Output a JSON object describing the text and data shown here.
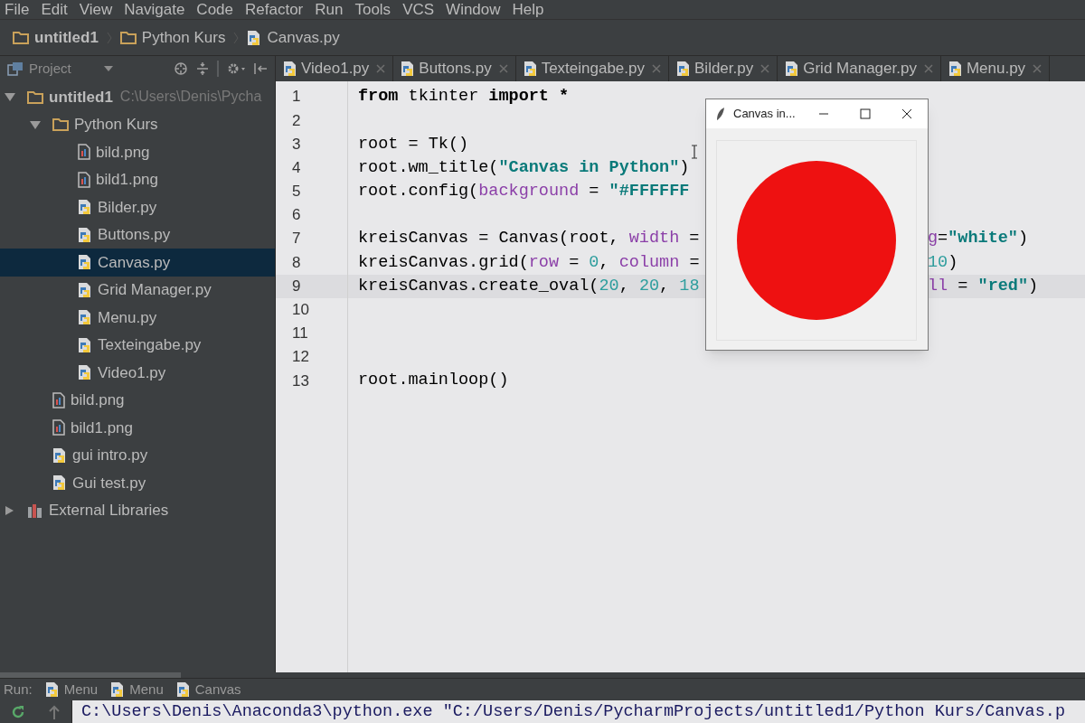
{
  "menu": [
    "File",
    "Edit",
    "View",
    "Navigate",
    "Code",
    "Refactor",
    "Run",
    "Tools",
    "VCS",
    "Window",
    "Help"
  ],
  "breadcrumbs": [
    {
      "label": "untitled1",
      "kind": "project"
    },
    {
      "label": "Python Kurs",
      "kind": "folder"
    },
    {
      "label": "Canvas.py",
      "kind": "python"
    }
  ],
  "project_panel": {
    "title": "Project"
  },
  "tabs": [
    {
      "label": "Video1.py",
      "selected": false
    },
    {
      "label": "Buttons.py",
      "selected": false
    },
    {
      "label": "Texteingabe.py",
      "selected": false
    },
    {
      "label": "Bilder.py",
      "selected": false
    },
    {
      "label": "Grid Manager.py",
      "selected": false
    },
    {
      "label": "Menu.py",
      "selected": false
    }
  ],
  "tree": [
    {
      "label": "untitled1",
      "path": "C:\\Users\\Denis\\Pycha",
      "kind": "project",
      "expanded": true,
      "selected": false,
      "children": [
        {
          "label": "Python Kurs",
          "kind": "folder",
          "expanded": true,
          "selected": false,
          "children": [
            {
              "label": "bild.png",
              "kind": "image",
              "selected": false
            },
            {
              "label": "bild1.png",
              "kind": "image",
              "selected": false
            },
            {
              "label": "Bilder.py",
              "kind": "python",
              "selected": false
            },
            {
              "label": "Buttons.py",
              "kind": "python",
              "selected": false
            },
            {
              "label": "Canvas.py",
              "kind": "python",
              "selected": true
            },
            {
              "label": "Grid Manager.py",
              "kind": "python",
              "selected": false
            },
            {
              "label": "Menu.py",
              "kind": "python",
              "selected": false
            },
            {
              "label": "Texteingabe.py",
              "kind": "python",
              "selected": false
            },
            {
              "label": "Video1.py",
              "kind": "python",
              "selected": false
            }
          ]
        },
        {
          "label": "bild.png",
          "kind": "image",
          "selected": false
        },
        {
          "label": "bild1.png",
          "kind": "image",
          "selected": false
        },
        {
          "label": "gui intro.py",
          "kind": "python",
          "selected": false
        },
        {
          "label": "Gui test.py",
          "kind": "python",
          "selected": false
        }
      ]
    },
    {
      "label": "External Libraries",
      "kind": "library",
      "expanded": false,
      "selected": false
    }
  ],
  "editor": {
    "lines": [
      {
        "number": "1",
        "current": false,
        "left": [
          {
            "text": "from",
            "kind": "keyword"
          },
          {
            "text": " tkinter ",
            "kind": "plain"
          },
          {
            "text": "import",
            "kind": "keyword"
          },
          {
            "text": " *",
            "kind": "keyword"
          }
        ]
      },
      {
        "number": "2",
        "current": false
      },
      {
        "number": "3",
        "current": false,
        "left": [
          {
            "text": "root = Tk()",
            "kind": "plain"
          }
        ]
      },
      {
        "number": "4",
        "current": false,
        "left": [
          {
            "text": "root.wm_title(",
            "kind": "plain"
          },
          {
            "text": "\"Canvas in Python\"",
            "kind": "string"
          },
          {
            "text": ")",
            "kind": "plain"
          }
        ]
      },
      {
        "number": "5",
        "current": false,
        "left": [
          {
            "text": "root.config(",
            "kind": "plain"
          },
          {
            "text": "background",
            "kind": "param"
          },
          {
            "text": " = ",
            "kind": "plain"
          },
          {
            "text": "\"#FFFFFF",
            "kind": "string"
          }
        ]
      },
      {
        "number": "6",
        "current": false
      },
      {
        "number": "7",
        "current": false,
        "left": [
          {
            "text": "kreisCanvas = Canvas(root, ",
            "kind": "plain"
          },
          {
            "text": "width",
            "kind": "param"
          },
          {
            "text": " =",
            "kind": "plain"
          }
        ],
        "right": [
          {
            "text": "g",
            "kind": "param"
          },
          {
            "text": "=",
            "kind": "plain"
          },
          {
            "text": "\"white\"",
            "kind": "string"
          },
          {
            "text": ")",
            "kind": "plain"
          }
        ]
      },
      {
        "number": "8",
        "current": false,
        "left": [
          {
            "text": "kreisCanvas.grid(",
            "kind": "plain"
          },
          {
            "text": "row",
            "kind": "param"
          },
          {
            "text": " = ",
            "kind": "plain"
          },
          {
            "text": "0",
            "kind": "number"
          },
          {
            "text": ", ",
            "kind": "plain"
          },
          {
            "text": "column",
            "kind": "param"
          },
          {
            "text": " =",
            "kind": "plain"
          }
        ],
        "right": [
          {
            "text": "10",
            "kind": "number"
          },
          {
            "text": ")",
            "kind": "plain"
          }
        ]
      },
      {
        "number": "9",
        "current": true,
        "left": [
          {
            "text": "kreisCanvas.create_oval(",
            "kind": "plain"
          },
          {
            "text": "20",
            "kind": "number"
          },
          {
            "text": ", ",
            "kind": "plain"
          },
          {
            "text": "20",
            "kind": "number"
          },
          {
            "text": ", ",
            "kind": "plain"
          },
          {
            "text": "18",
            "kind": "number"
          }
        ],
        "right": [
          {
            "text": "ll",
            "kind": "param"
          },
          {
            "text": " = ",
            "kind": "plain"
          },
          {
            "text": "\"red\"",
            "kind": "string"
          },
          {
            "text": ")",
            "kind": "plain"
          }
        ]
      },
      {
        "number": "10",
        "current": false
      },
      {
        "number": "11",
        "current": false
      },
      {
        "number": "12",
        "current": false
      },
      {
        "number": "13",
        "current": false,
        "left": [
          {
            "text": "root.mainloop()",
            "kind": "plain"
          }
        ]
      }
    ]
  },
  "tk_window": {
    "title": "Canvas in..."
  },
  "run_bar": {
    "label": "Run:",
    "tabs": [
      {
        "label": "Menu"
      },
      {
        "label": "Menu"
      },
      {
        "label": "Canvas"
      }
    ]
  },
  "console": {
    "text": "C:\\Users\\Denis\\Anaconda3\\python.exe \"C:/Users/Denis/PycharmProjects/untitled1/Python Kurs/Canvas.p"
  }
}
